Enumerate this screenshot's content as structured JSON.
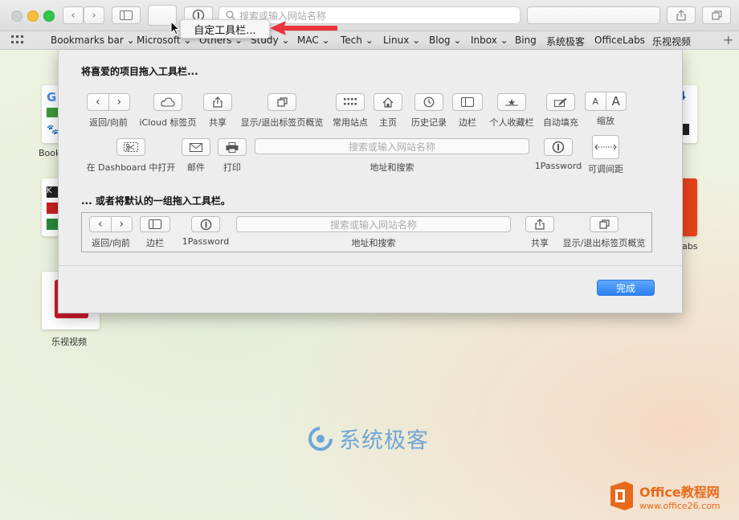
{
  "toolbar": {
    "address_placeholder": "搜索或输入网站名称",
    "nav_back_glyph": "‹",
    "nav_forward_glyph": "›"
  },
  "bookmarks": [
    "Bookmarks bar",
    "Microsoft",
    "Others",
    "Study",
    "MAC",
    "Tech",
    "Linux",
    "Blog",
    "Inbox",
    "Bing",
    "系统极客",
    "OfficeLabs",
    "乐视视频"
  ],
  "tooltip": {
    "label": "自定工具栏..."
  },
  "background": {
    "tile_labels": [
      "Book",
      "乐视视频",
      "Labs"
    ]
  },
  "sheet": {
    "favorites_title": "将喜爱的项目拖入工具栏...",
    "default_title": "... 或者将默认的一组拖入工具栏。",
    "done_label": "完成",
    "items_row1": [
      {
        "label": "返回/向前",
        "icon": "back-forward-icon"
      },
      {
        "label": "iCloud 标签页",
        "icon": "cloud-icon"
      },
      {
        "label": "共享",
        "icon": "share-icon"
      },
      {
        "label": "显示/退出标签页概览",
        "icon": "tabs-overview-icon"
      },
      {
        "label": "常用站点",
        "icon": "grid-icon"
      },
      {
        "label": "主页",
        "icon": "home-icon"
      },
      {
        "label": "历史记录",
        "icon": "clock-icon"
      },
      {
        "label": "边栏",
        "icon": "sidebar-icon"
      },
      {
        "label": "个人收藏栏",
        "icon": "star-icon"
      },
      {
        "label": "自动填充",
        "icon": "pen-icon"
      },
      {
        "label": "缩放",
        "icon": "zoom-icon",
        "glyph_small": "A",
        "glyph_large": "A"
      }
    ],
    "items_row2": [
      {
        "label": "在 Dashboard 中打开",
        "icon": "dashboard-scissors-icon"
      },
      {
        "label": "邮件",
        "icon": "mail-icon"
      },
      {
        "label": "打印",
        "icon": "print-icon"
      },
      {
        "label": "地址和搜索",
        "icon": "address-field",
        "placeholder": "搜索或输入网站名称"
      },
      {
        "label": "1Password",
        "icon": "onepassword-icon"
      },
      {
        "label": "可调间距",
        "icon": "flexible-space-icon"
      }
    ],
    "default_items": [
      {
        "label": "返回/向前",
        "icon": "back-forward-icon"
      },
      {
        "label": "边栏",
        "icon": "sidebar-icon"
      },
      {
        "label": "1Password",
        "icon": "onepassword-icon"
      },
      {
        "label": "地址和搜索",
        "icon": "address-field",
        "placeholder": "搜索或输入网站名称"
      },
      {
        "label": "共享",
        "icon": "share-icon"
      },
      {
        "label": "显示/退出标签页概览",
        "icon": "tabs-overview-icon"
      }
    ]
  },
  "watermark": {
    "text": "系统极客"
  },
  "logo": {
    "line1": "Office教程网",
    "line2": "www.office26.com"
  },
  "colors": {
    "accent": "#2d83f4",
    "arrow": "#e8343c",
    "logo": "#e8691a",
    "watermark": "#6fa6d8"
  }
}
